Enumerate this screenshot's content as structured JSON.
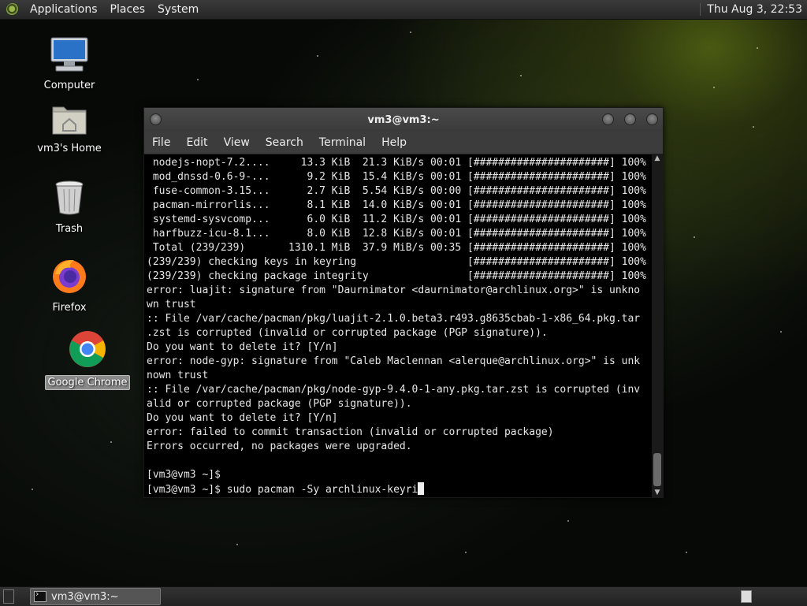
{
  "top_panel": {
    "menus": [
      "Applications",
      "Places",
      "System"
    ],
    "clock": "Thu Aug  3, 22:53"
  },
  "desktop_icons": [
    {
      "label": "Computer",
      "icon": "computer-icon"
    },
    {
      "label": "vm3's Home",
      "icon": "home-folder-icon"
    },
    {
      "label": "Trash",
      "icon": "trash-icon"
    },
    {
      "label": "Firefox",
      "icon": "firefox-icon"
    },
    {
      "label": "Google Chrome",
      "icon": "chrome-icon",
      "selected": true
    }
  ],
  "terminal": {
    "title": "vm3@vm3:~",
    "menus": [
      "File",
      "Edit",
      "View",
      "Search",
      "Terminal",
      "Help"
    ],
    "lines": [
      " nodejs-nopt-7.2....     13.3 KiB  21.3 KiB/s 00:01 [######################] 100%",
      " mod_dnssd-0.6-9-...      9.2 KiB  15.4 KiB/s 00:01 [######################] 100%",
      " fuse-common-3.15...      2.7 KiB  5.54 KiB/s 00:00 [######################] 100%",
      " pacman-mirrorlis...      8.1 KiB  14.0 KiB/s 00:01 [######################] 100%",
      " systemd-sysvcomp...      6.0 KiB  11.2 KiB/s 00:01 [######################] 100%",
      " harfbuzz-icu-8.1...      8.0 KiB  12.8 KiB/s 00:01 [######################] 100%",
      " Total (239/239)       1310.1 MiB  37.9 MiB/s 00:35 [######################] 100%",
      "(239/239) checking keys in keyring                  [######################] 100%",
      "(239/239) checking package integrity                [######################] 100%",
      "error: luajit: signature from \"Daurnimator <daurnimator@archlinux.org>\" is unkno",
      "wn trust",
      ":: File /var/cache/pacman/pkg/luajit-2.1.0.beta3.r493.g8635cbab-1-x86_64.pkg.tar",
      ".zst is corrupted (invalid or corrupted package (PGP signature)).",
      "Do you want to delete it? [Y/n]",
      "error: node-gyp: signature from \"Caleb Maclennan <alerque@archlinux.org>\" is unk",
      "nown trust",
      ":: File /var/cache/pacman/pkg/node-gyp-9.4.0-1-any.pkg.tar.zst is corrupted (inv",
      "alid or corrupted package (PGP signature)).",
      "Do you want to delete it? [Y/n]",
      "error: failed to commit transaction (invalid or corrupted package)",
      "Errors occurred, no packages were upgraded.",
      "",
      "[vm3@vm3 ~]$",
      "[vm3@vm3 ~]$ sudo pacman -Sy archlinux-keyri"
    ]
  },
  "taskbar": {
    "window_label": "vm3@vm3:~"
  }
}
